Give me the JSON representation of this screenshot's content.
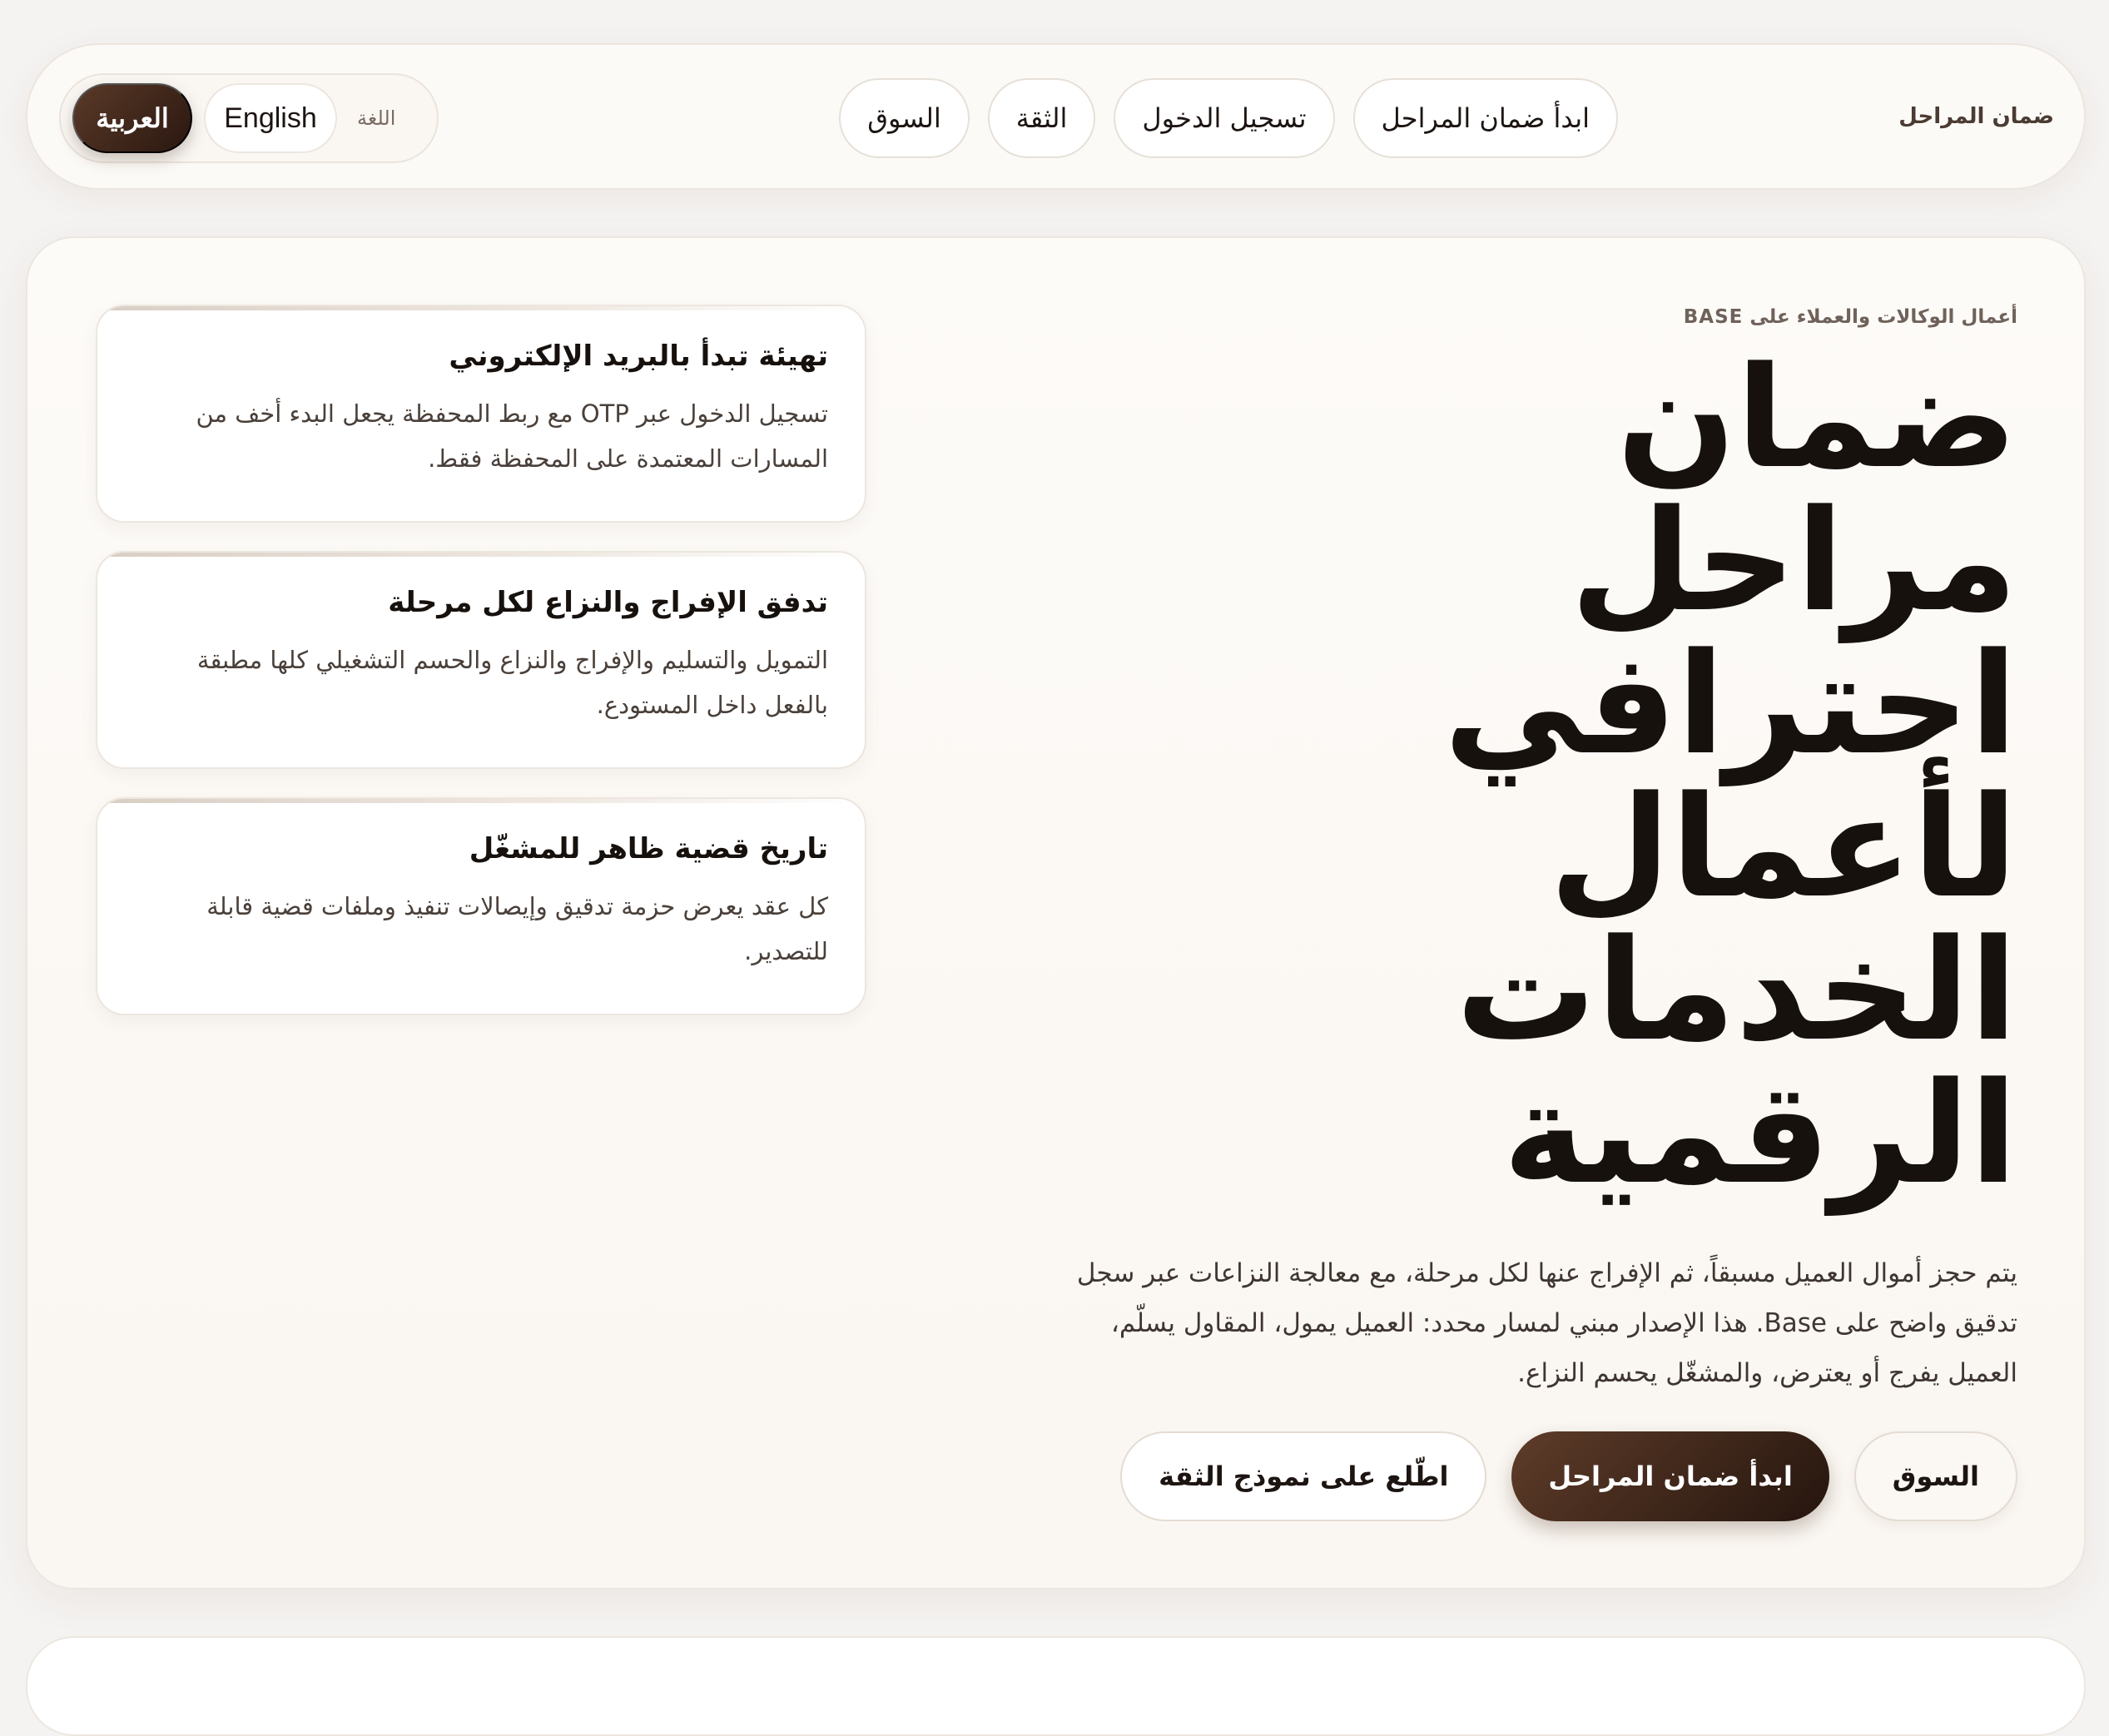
{
  "brand": "ضمان المراحل",
  "nav": {
    "items": [
      "السوق",
      "الثقة",
      "تسجيل الدخول",
      "ابدأ ضمان المراحل"
    ]
  },
  "language": {
    "label": "اللغة",
    "english": "English",
    "arabic": "العربية",
    "selected": "العربية"
  },
  "hero": {
    "eyebrow": "أعمال الوكالات والعملاء على BASE",
    "headline_lines": [
      "ضمان",
      "مراحل",
      "احترافي",
      "لأعمال",
      "الخدمات",
      "الرقمية"
    ],
    "lead": "يتم حجز أموال العميل مسبقاً، ثم الإفراج عنها لكل مرحلة، مع معالجة النزاعات عبر سجل تدقيق واضح على Base. هذا الإصدار مبني لمسار محدد: العميل يمول، المقاول يسلّم، العميل يفرج أو يعترض، والمشغّل يحسم النزاع.",
    "cta": {
      "market": "السوق",
      "start": "ابدأ ضمان المراحل",
      "trust": "اطّلع على نموذج الثقة"
    }
  },
  "features": [
    {
      "title": "تهيئة تبدأ بالبريد الإلكتروني",
      "body": "تسجيل الدخول عبر OTP مع ربط المحفظة يجعل البدء أخف من المسارات المعتمدة على المحفظة فقط."
    },
    {
      "title": "تدفق الإفراج والنزاع لكل مرحلة",
      "body": "التمويل والتسليم والإفراج والنزاع والحسم التشغيلي كلها مطبقة بالفعل داخل المستودع."
    },
    {
      "title": "تاريخ قضية ظاهر للمشغّل",
      "body": "كل عقد يعرض حزمة تدقيق وإيصالات تنفيذ وملفات قضية قابلة للتصدير."
    }
  ]
}
